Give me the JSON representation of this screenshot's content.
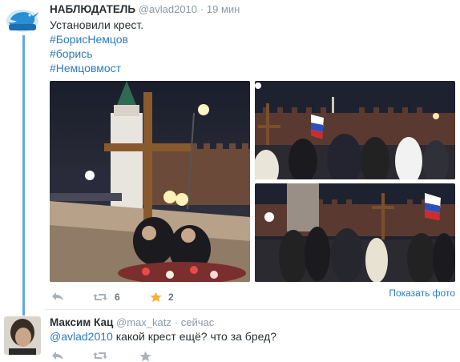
{
  "tweet1": {
    "name": "НАБЛЮДАТЕЛЬ",
    "handle": "@avlad2010",
    "dot": "·",
    "time": "19 мин",
    "text": "Установили крест.",
    "hashtags": [
      "#БорисНемцов",
      "#борись",
      "#Немцовмост"
    ],
    "avatar_icon": "twitter-bird-logo",
    "retweets": "6",
    "favorites": "2",
    "show_photo": "Показать фото"
  },
  "tweet2": {
    "name": "Максим Кац",
    "handle": "@max_katz",
    "dot": "·",
    "time": "сейчас",
    "mention": "@avlad2010",
    "text": " какой крест ещё? что за бред?"
  },
  "colors": {
    "link": "#2b7bb9",
    "thread_line": "#5ea9dd",
    "favorite_star": "#ffac33",
    "muted": "#8899a6"
  }
}
